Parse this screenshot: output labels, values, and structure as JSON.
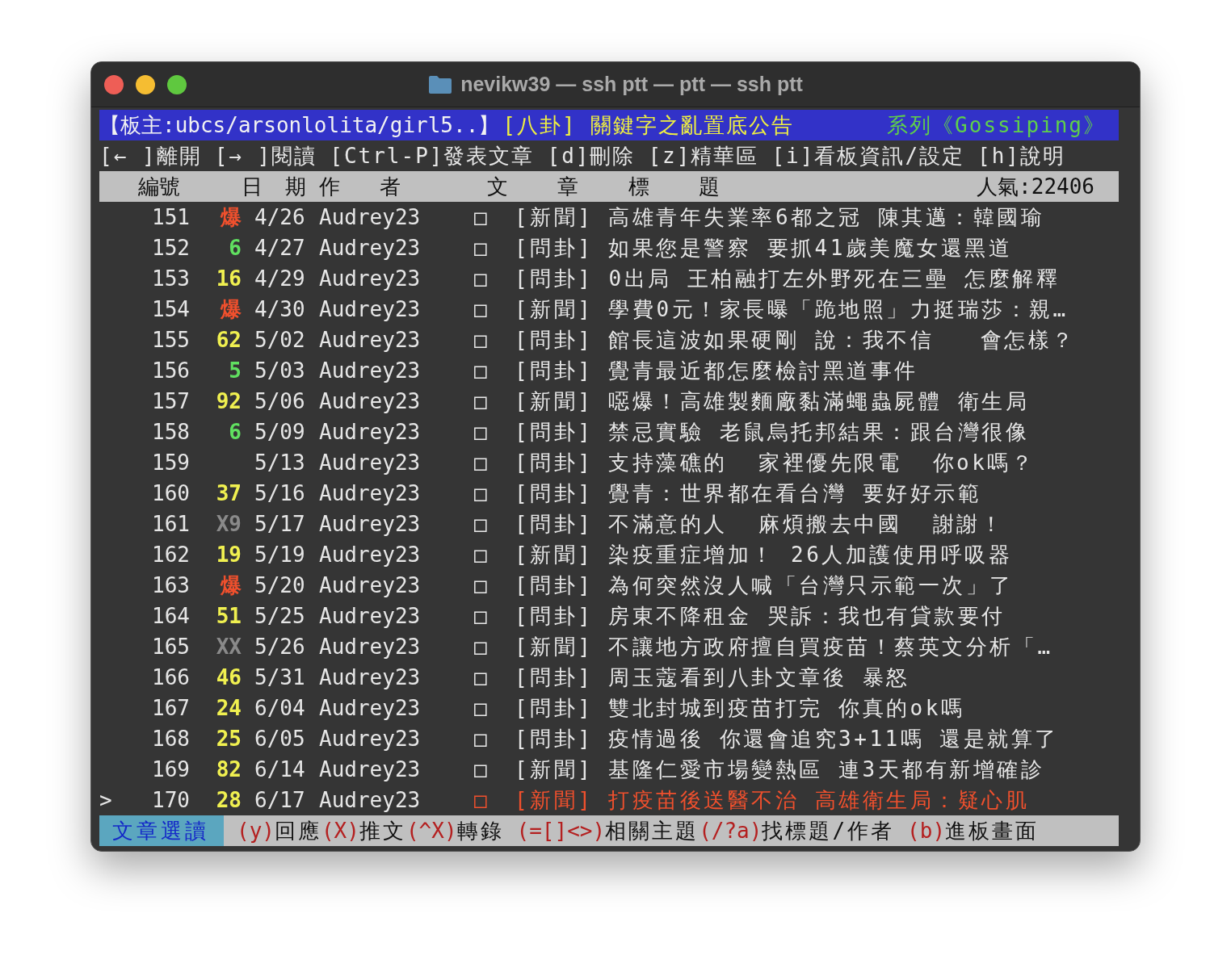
{
  "window": {
    "title": "nevikw39 — ssh ptt — ptt — ssh ptt"
  },
  "board_header": {
    "moderator": "【板主:ubcs/arsonlolita/girl5..】",
    "notice": "[八卦] 關鍵字之亂置底公告",
    "series": "系列《Gossiping》"
  },
  "commands": [
    "[← ]離開",
    "[→ ]閱讀",
    "[Ctrl-P]發表文章",
    "[d]刪除",
    "[z]精華區",
    "[i]看板資訊/設定",
    "[h]說明"
  ],
  "columns": {
    "number": "編號",
    "date": "日 期",
    "author": "作  者",
    "title": "文  章  標  題",
    "popularity": "人氣:22406"
  },
  "posts": [
    {
      "number": "151",
      "recommend": {
        "text": "爆",
        "kind": "hot"
      },
      "date": "4/26",
      "author": "Audrey23",
      "mark": "□",
      "title": "[新聞] 高雄青年失業率6都之冠 陳其邁：韓國瑜",
      "selected": false
    },
    {
      "number": "152",
      "recommend": {
        "text": "6",
        "kind": "low"
      },
      "date": "4/27",
      "author": "Audrey23",
      "mark": "□",
      "title": "[問卦] 如果您是警察 要抓41歲美魔女還黑道",
      "selected": false
    },
    {
      "number": "153",
      "recommend": {
        "text": "16",
        "kind": "high"
      },
      "date": "4/29",
      "author": "Audrey23",
      "mark": "□",
      "title": "[問卦] 0出局 王柏融打左外野死在三壘 怎麼解釋",
      "selected": false
    },
    {
      "number": "154",
      "recommend": {
        "text": "爆",
        "kind": "hot"
      },
      "date": "4/30",
      "author": "Audrey23",
      "mark": "□",
      "title": "[新聞] 學費0元！家長曝「跪地照」力挺瑞莎：親…",
      "selected": false
    },
    {
      "number": "155",
      "recommend": {
        "text": "62",
        "kind": "high"
      },
      "date": "5/02",
      "author": "Audrey23",
      "mark": "□",
      "title": "[問卦] 館長這波如果硬剛 說：我不信   會怎樣？",
      "selected": false
    },
    {
      "number": "156",
      "recommend": {
        "text": "5",
        "kind": "low"
      },
      "date": "5/03",
      "author": "Audrey23",
      "mark": "□",
      "title": "[問卦] 覺青最近都怎麼檢討黑道事件",
      "selected": false
    },
    {
      "number": "157",
      "recommend": {
        "text": "92",
        "kind": "high"
      },
      "date": "5/06",
      "author": "Audrey23",
      "mark": "□",
      "title": "[新聞] 噁爆！高雄製麵廠黏滿蠅蟲屍體 衛生局",
      "selected": false
    },
    {
      "number": "158",
      "recommend": {
        "text": "6",
        "kind": "low"
      },
      "date": "5/09",
      "author": "Audrey23",
      "mark": "□",
      "title": "[問卦] 禁忌實驗 老鼠烏托邦結果：跟台灣很像",
      "selected": false
    },
    {
      "number": "159",
      "date": "5/13",
      "author": "Audrey23",
      "mark": "□",
      "title": "[問卦] 支持藻礁的  家裡優先限電  你ok嗎？",
      "selected": false
    },
    {
      "number": "160",
      "recommend": {
        "text": "37",
        "kind": "high"
      },
      "date": "5/16",
      "author": "Audrey23",
      "mark": "□",
      "title": "[問卦] 覺青：世界都在看台灣 要好好示範",
      "selected": false
    },
    {
      "number": "161",
      "recommend": {
        "text": "X9",
        "kind": "boo"
      },
      "date": "5/17",
      "author": "Audrey23",
      "mark": "□",
      "title": "[問卦] 不滿意的人  麻煩搬去中國  謝謝！",
      "selected": false
    },
    {
      "number": "162",
      "recommend": {
        "text": "19",
        "kind": "high"
      },
      "date": "5/19",
      "author": "Audrey23",
      "mark": "□",
      "title": "[新聞] 染疫重症增加！ 26人加護使用呼吸器",
      "selected": false
    },
    {
      "number": "163",
      "recommend": {
        "text": "爆",
        "kind": "hot"
      },
      "date": "5/20",
      "author": "Audrey23",
      "mark": "□",
      "title": "[問卦] 為何突然沒人喊「台灣只示範一次」了",
      "selected": false
    },
    {
      "number": "164",
      "recommend": {
        "text": "51",
        "kind": "high"
      },
      "date": "5/25",
      "author": "Audrey23",
      "mark": "□",
      "title": "[問卦] 房東不降租金 哭訴：我也有貸款要付",
      "selected": false
    },
    {
      "number": "165",
      "recommend": {
        "text": "XX",
        "kind": "boo"
      },
      "date": "5/26",
      "author": "Audrey23",
      "mark": "□",
      "title": "[新聞] 不讓地方政府擅自買疫苗！蔡英文分析「…",
      "selected": false
    },
    {
      "number": "166",
      "recommend": {
        "text": "46",
        "kind": "high"
      },
      "date": "5/31",
      "author": "Audrey23",
      "mark": "□",
      "title": "[問卦] 周玉蔻看到八卦文章後 暴怒",
      "selected": false
    },
    {
      "number": "167",
      "recommend": {
        "text": "24",
        "kind": "high"
      },
      "date": "6/04",
      "author": "Audrey23",
      "mark": "□",
      "title": "[問卦] 雙北封城到疫苗打完 你真的ok嗎",
      "selected": false
    },
    {
      "number": "168",
      "recommend": {
        "text": "25",
        "kind": "high"
      },
      "date": "6/05",
      "author": "Audrey23",
      "mark": "□",
      "title": "[問卦] 疫情過後 你還會追究3+11嗎 還是就算了",
      "selected": false
    },
    {
      "number": "169",
      "recommend": {
        "text": "82",
        "kind": "high"
      },
      "date": "6/14",
      "author": "Audrey23",
      "mark": "□",
      "title": "[新聞] 基隆仁愛市場變熱區 連3天都有新增確診",
      "selected": false
    },
    {
      "number": "170",
      "recommend": {
        "text": "28",
        "kind": "high"
      },
      "date": "6/17",
      "author": "Audrey23",
      "mark": "□",
      "title": "[新聞] 打疫苗後送醫不治 高雄衛生局：疑心肌",
      "selected": true,
      "cursor": ">"
    }
  ],
  "footer": {
    "mode": "文章選讀",
    "hints": [
      {
        "key": "(y)",
        "label": "回應"
      },
      {
        "key": "(X)",
        "label": "推文"
      },
      {
        "key": "(^X)",
        "label": "轉錄"
      },
      {
        "key": "(=[]<>)",
        "label": "相關主題"
      },
      {
        "key": "(/?a)",
        "label": "找標題/作者"
      },
      {
        "key": "(b)",
        "label": "進板畫面"
      }
    ]
  }
}
